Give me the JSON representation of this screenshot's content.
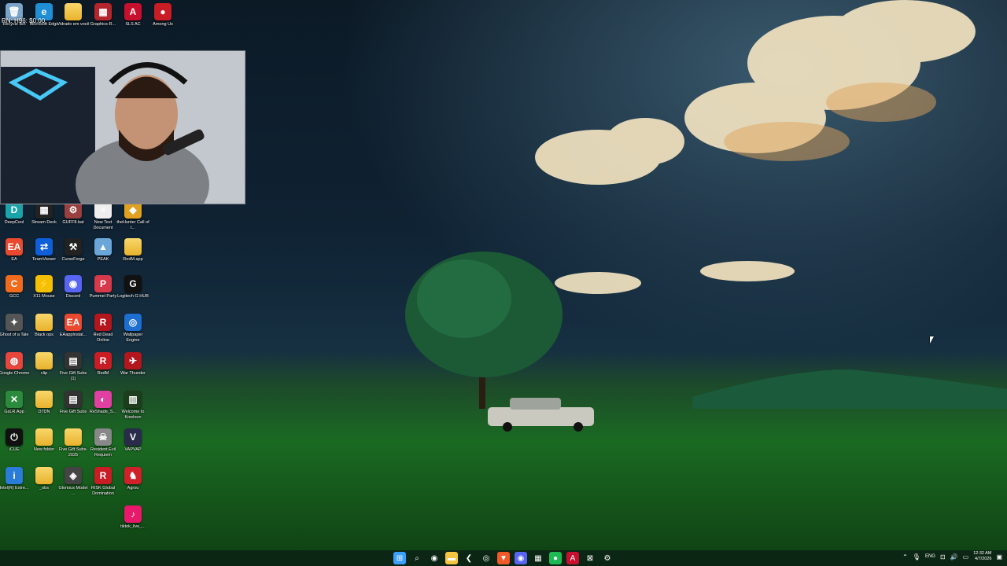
{
  "overlay": {
    "text": "RN: H96: $0.00"
  },
  "desktop_icons": [
    {
      "label": "Recycle Bin",
      "icon": "recycle-bin-icon",
      "color": "#7aa4c8",
      "glyph": "🗑"
    },
    {
      "label": "Microsoft Edge",
      "icon": "edge-icon",
      "color": "#1f8fd6",
      "glyph": "e"
    },
    {
      "label": "Vidrado em você",
      "icon": "folder-icon",
      "color": "#f5c542",
      "glyph": ""
    },
    {
      "label": "Graphics-R...",
      "icon": "archive-icon",
      "color": "#b3262d",
      "glyph": "▦"
    },
    {
      "label": "SLS AC",
      "icon": "app-icon",
      "color": "#c8102e",
      "glyph": "A"
    },
    {
      "label": "Among Us",
      "icon": "game-icon",
      "color": "#c81d25",
      "glyph": "●"
    },
    {
      "label": "DeepCool",
      "icon": "deepcool-icon",
      "color": "#1aa3a8",
      "glyph": "D"
    },
    {
      "label": "Stream Deck",
      "icon": "stream-deck-icon",
      "color": "#222",
      "glyph": "▦"
    },
    {
      "label": "GUFF8.bat",
      "icon": "script-icon",
      "color": "#9a3f3f",
      "glyph": "⚙"
    },
    {
      "label": "New Text Document",
      "icon": "text-file-icon",
      "color": "#eeeeee",
      "glyph": "≡"
    },
    {
      "label": "theHunter Call of t...",
      "icon": "game-icon",
      "color": "#e0a020",
      "glyph": "◆"
    },
    {
      "label": "EA",
      "icon": "ea-icon",
      "color": "#e8492f",
      "glyph": "EA"
    },
    {
      "label": "TeamViewer",
      "icon": "teamviewer-icon",
      "color": "#0e5fd8",
      "glyph": "⇄"
    },
    {
      "label": "CurseForge",
      "icon": "curseforge-icon",
      "color": "#222",
      "glyph": "⚒"
    },
    {
      "label": "PEAK",
      "icon": "game-icon",
      "color": "#6aa6d8",
      "glyph": "▲"
    },
    {
      "label": "RedM.app",
      "icon": "folder-icon",
      "color": "#f5c542",
      "glyph": ""
    },
    {
      "label": "GCC",
      "icon": "app-icon",
      "color": "#f26b1d",
      "glyph": "C"
    },
    {
      "label": "X11 Mouse",
      "icon": "mouse-icon",
      "color": "#f4c000",
      "glyph": "⚡"
    },
    {
      "label": "Discord",
      "icon": "discord-icon",
      "color": "#5865f2",
      "glyph": "◉"
    },
    {
      "label": "Pummel Party",
      "icon": "game-icon",
      "color": "#d63a4a",
      "glyph": "P"
    },
    {
      "label": "Logitech G HUB",
      "icon": "logitech-icon",
      "color": "#111",
      "glyph": "G"
    },
    {
      "label": "Ghost of a Tale",
      "icon": "game-icon",
      "color": "#555",
      "glyph": "✦"
    },
    {
      "label": "Black ops",
      "icon": "folder-icon",
      "color": "#f5c542",
      "glyph": ""
    },
    {
      "label": "EAappInstal...",
      "icon": "ea-icon",
      "color": "#e8492f",
      "glyph": "EA"
    },
    {
      "label": "Red Dead Online",
      "icon": "game-icon",
      "color": "#b3161d",
      "glyph": "R"
    },
    {
      "label": "Wallpaper Engine",
      "icon": "wallpaper-engine-icon",
      "color": "#1c6fd0",
      "glyph": "◎"
    },
    {
      "label": "Google Chrome",
      "icon": "chrome-icon",
      "color": "#e8453c",
      "glyph": "◍"
    },
    {
      "label": "clip",
      "icon": "folder-icon",
      "color": "#f5c542",
      "glyph": ""
    },
    {
      "label": "Five Gift Subs (1)",
      "icon": "video-icon",
      "color": "#333",
      "glyph": "▤"
    },
    {
      "label": "RedM",
      "icon": "game-icon",
      "color": "#c81d25",
      "glyph": "R"
    },
    {
      "label": "War Thunder",
      "icon": "game-icon",
      "color": "#b3161d",
      "glyph": "✈"
    },
    {
      "label": "GsLR.App",
      "icon": "app-icon",
      "color": "#2b8a3e",
      "glyph": "✕"
    },
    {
      "label": "D7DN",
      "icon": "folder-icon",
      "color": "#f5c542",
      "glyph": ""
    },
    {
      "label": "Five Gift Subs",
      "icon": "video-icon",
      "color": "#333",
      "glyph": "▤"
    },
    {
      "label": "ReShade_S...",
      "icon": "reshade-icon",
      "color": "#e040a0",
      "glyph": "◐"
    },
    {
      "label": "Welcome to Kowloon",
      "icon": "game-icon",
      "color": "#1d3d1d",
      "glyph": "▥"
    },
    {
      "label": "iCUE",
      "icon": "icue-icon",
      "color": "#111",
      "glyph": "⏻"
    },
    {
      "label": "New folder",
      "icon": "folder-icon",
      "color": "#f5c542",
      "glyph": ""
    },
    {
      "label": "Five Gift Subs-2025",
      "icon": "folder-icon",
      "color": "#f5c542",
      "glyph": ""
    },
    {
      "label": "Resident Evil Requiem",
      "icon": "game-icon",
      "color": "#888",
      "glyph": "☠"
    },
    {
      "label": "VAPVAP",
      "icon": "app-icon",
      "color": "#2a2a4a",
      "glyph": "V"
    },
    {
      "label": "Intel(R) Extre...",
      "icon": "intel-icon",
      "color": "#2b7bd8",
      "glyph": "i"
    },
    {
      "label": "_obs",
      "icon": "folder-icon",
      "color": "#f5c542",
      "glyph": ""
    },
    {
      "label": "Glorious Model ...",
      "icon": "mouse-icon",
      "color": "#444",
      "glyph": "◈"
    },
    {
      "label": "RISK Global Domination",
      "icon": "game-icon",
      "color": "#c81d25",
      "glyph": "R"
    },
    {
      "label": "Agrou",
      "icon": "game-icon",
      "color": "#d0202a",
      "glyph": "♞"
    },
    {
      "label": "tiktok_live_...",
      "icon": "tiktok-icon",
      "color": "#e8196b",
      "glyph": "♪"
    }
  ],
  "taskbar": {
    "buttons": [
      {
        "name": "start-button",
        "glyph": "⊞",
        "color": "#3aa0ff"
      },
      {
        "name": "search-icon",
        "glyph": "⌕",
        "color": "transparent"
      },
      {
        "name": "obs-icon",
        "glyph": "◉",
        "color": "transparent"
      },
      {
        "name": "file-explorer-icon",
        "glyph": "▬",
        "color": "#f5c542"
      },
      {
        "name": "app-icon",
        "glyph": "❮",
        "color": "transparent"
      },
      {
        "name": "steam-icon",
        "glyph": "◎",
        "color": "transparent"
      },
      {
        "name": "brave-icon",
        "glyph": "▼",
        "color": "#f05a28"
      },
      {
        "name": "discord-icon",
        "glyph": "◉",
        "color": "#5865f2"
      },
      {
        "name": "app-icon",
        "glyph": "▦",
        "color": "transparent"
      },
      {
        "name": "spotify-icon",
        "glyph": "●",
        "color": "#1db954"
      },
      {
        "name": "adobe-icon",
        "glyph": "A",
        "color": "#c8102e"
      },
      {
        "name": "xbox-icon",
        "glyph": "⊠",
        "color": "transparent"
      },
      {
        "name": "settings-icon",
        "glyph": "⚙",
        "color": "transparent"
      }
    ],
    "tray": {
      "language": "ENG",
      "time": "12:32 AM",
      "date": "4/7/2026"
    }
  }
}
